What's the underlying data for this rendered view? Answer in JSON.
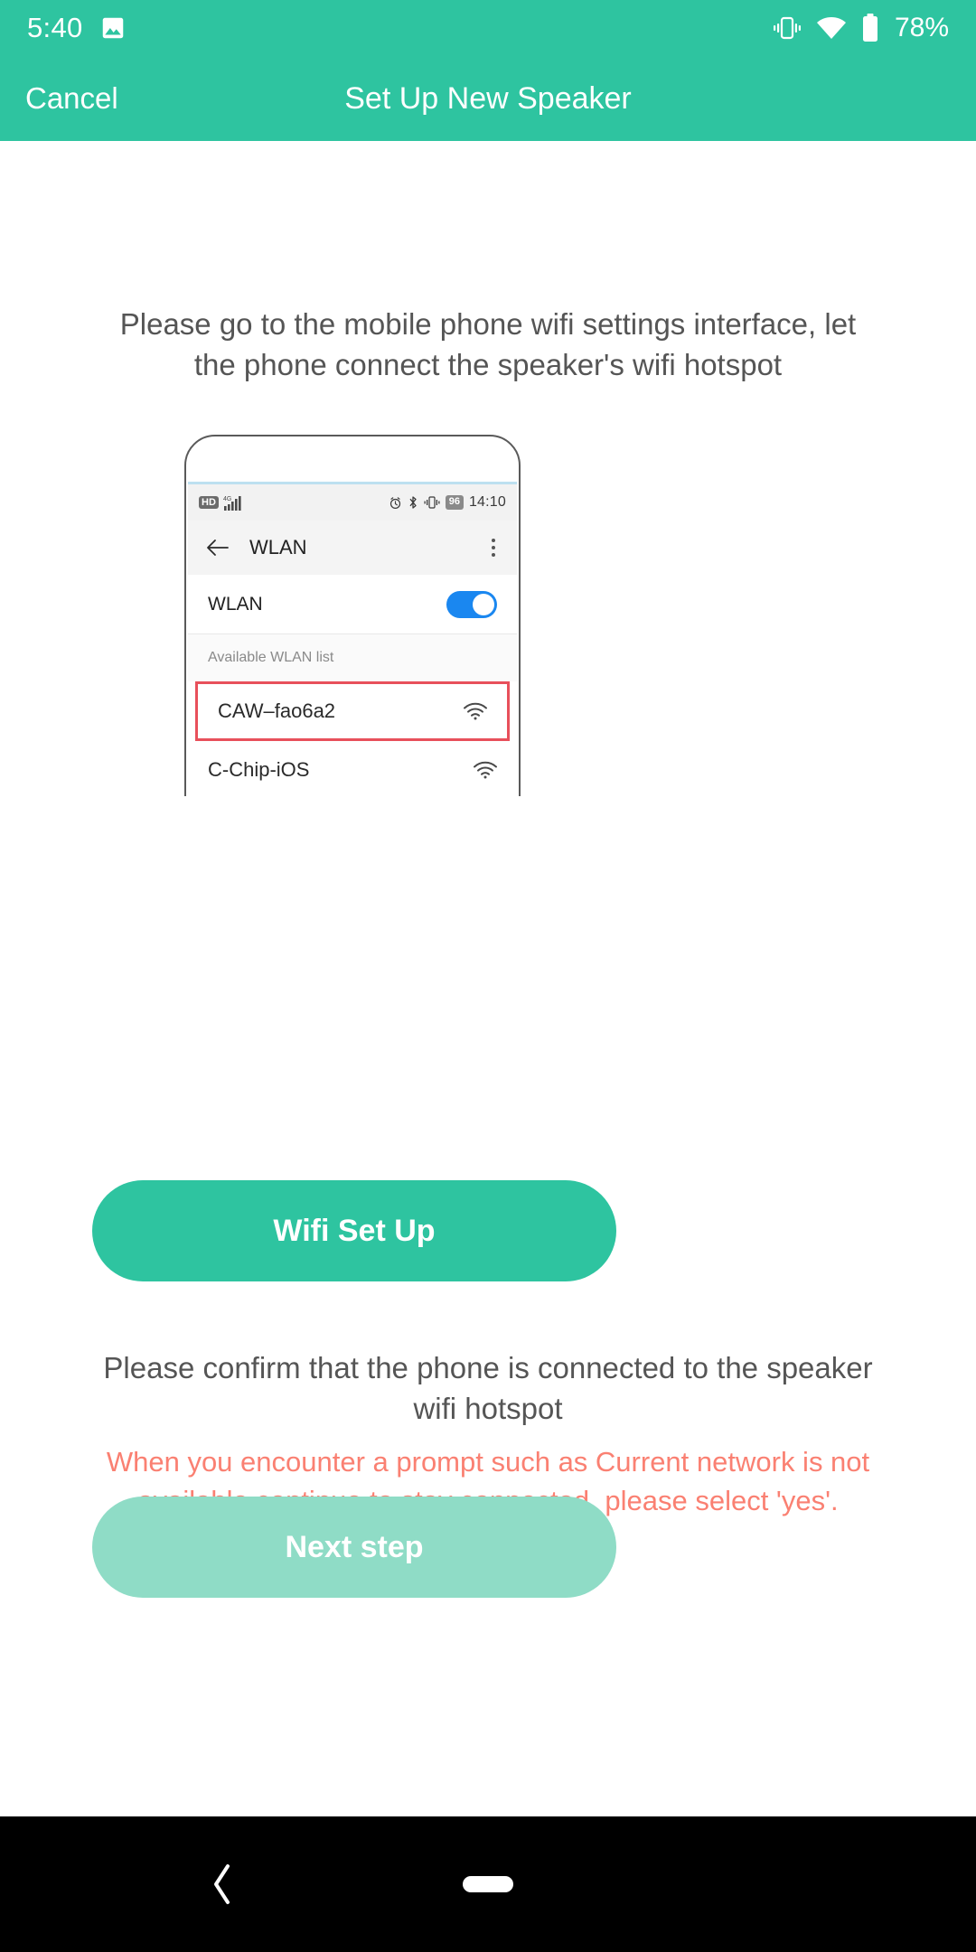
{
  "status_bar": {
    "clock": "5:40",
    "battery_percent": "78%",
    "icons": [
      "image-icon",
      "vibrate-icon",
      "wifi-icon",
      "battery-icon"
    ]
  },
  "app_bar": {
    "cancel_label": "Cancel",
    "title": "Set Up New Speaker"
  },
  "main": {
    "instruction": "Please go to the mobile phone wifi settings interface, let the phone connect the speaker's wifi hotspot",
    "wifi_setup_button": "Wifi Set Up",
    "confirm_text": "Please confirm that the phone is connected to the speaker wifi hotspot",
    "warning_text": "When you encounter a prompt such as Current network is not available,continue to stay connected, please select 'yes'.",
    "next_step_button": "Next step"
  },
  "phone_mockup": {
    "status_bar": {
      "hd_label": "HD",
      "network_label": "4G",
      "battery_label": "96",
      "clock": "14:10"
    },
    "app_bar_title": "WLAN",
    "toggle_row_label": "WLAN",
    "toggle_state": "on",
    "list_header": "Available WLAN list",
    "networks": [
      {
        "ssid": "CAW–fao6a2",
        "highlighted": true
      },
      {
        "ssid": "C-Chip-iOS",
        "highlighted": false
      }
    ]
  },
  "nav_bar": {
    "back_label": "back-icon",
    "home_label": "home-pill"
  },
  "colors": {
    "accent": "#2EC4A0",
    "accent_disabled": "#8FDCC6",
    "warning": "#FA8072",
    "highlight_border": "#e8505b",
    "toggle_on": "#1a87f0"
  }
}
